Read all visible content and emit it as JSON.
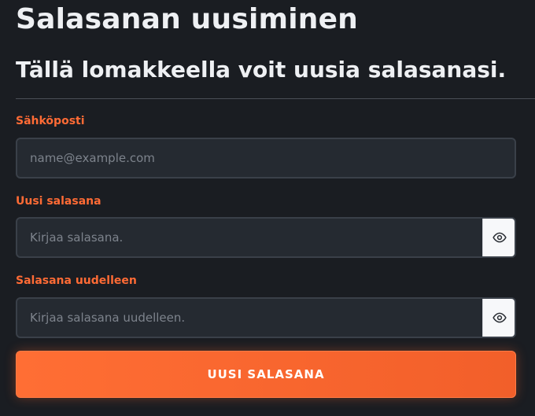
{
  "header": {
    "title": "Salasanan uusiminen",
    "subtitle": "Tällä lomakkeella voit uusia salasanasi."
  },
  "form": {
    "email": {
      "label": "Sähköposti",
      "placeholder": "name@example.com",
      "value": ""
    },
    "new_password": {
      "label": "Uusi salasana",
      "placeholder": "Kirjaa salasana.",
      "value": "",
      "toggle_icon": "eye-icon"
    },
    "confirm_password": {
      "label": "Salasana uudelleen",
      "placeholder": "Kirjaa salasana uudelleen.",
      "value": "",
      "toggle_icon": "eye-icon"
    },
    "submit_label": "UUSI SALASANA"
  },
  "colors": {
    "background": "#1a1d22",
    "accent": "#ff6b35",
    "input_background": "#252a31",
    "text": "#eef0f3"
  }
}
